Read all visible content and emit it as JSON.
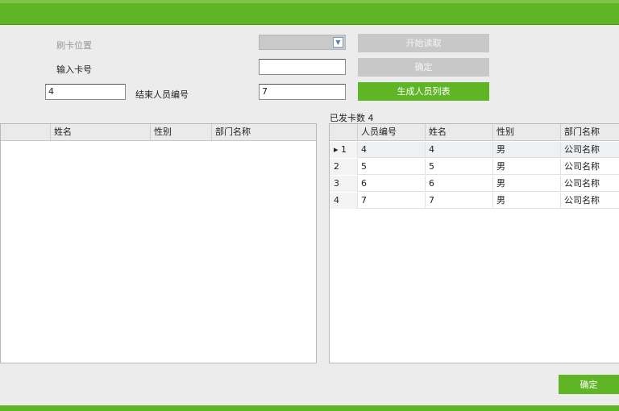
{
  "form": {
    "card_position_label": "刷卡位置",
    "card_no_label": "输入卡号",
    "start_value": "4",
    "end_label": "结束人员编号",
    "end_value": "7",
    "card_no_value": ""
  },
  "buttons": {
    "start_read": "开始读取",
    "confirm_top": "确定",
    "generate_list": "生成人员列表",
    "confirm_bottom": "确定"
  },
  "left_table": {
    "headers": [
      "姓名",
      "性别",
      "部门名称"
    ]
  },
  "right_table": {
    "issued_label": "已发卡数 4",
    "headers": [
      "人员编号",
      "姓名",
      "性别",
      "部门名称"
    ],
    "rows": [
      {
        "idx": "1",
        "marker": "▸",
        "id": "4",
        "name": "4",
        "gender": "男",
        "dept": "公司名称"
      },
      {
        "idx": "2",
        "marker": "",
        "id": "5",
        "name": "5",
        "gender": "男",
        "dept": "公司名称"
      },
      {
        "idx": "3",
        "marker": "",
        "id": "6",
        "name": "6",
        "gender": "男",
        "dept": "公司名称"
      },
      {
        "idx": "4",
        "marker": "",
        "id": "7",
        "name": "7",
        "gender": "男",
        "dept": "公司名称"
      }
    ]
  }
}
